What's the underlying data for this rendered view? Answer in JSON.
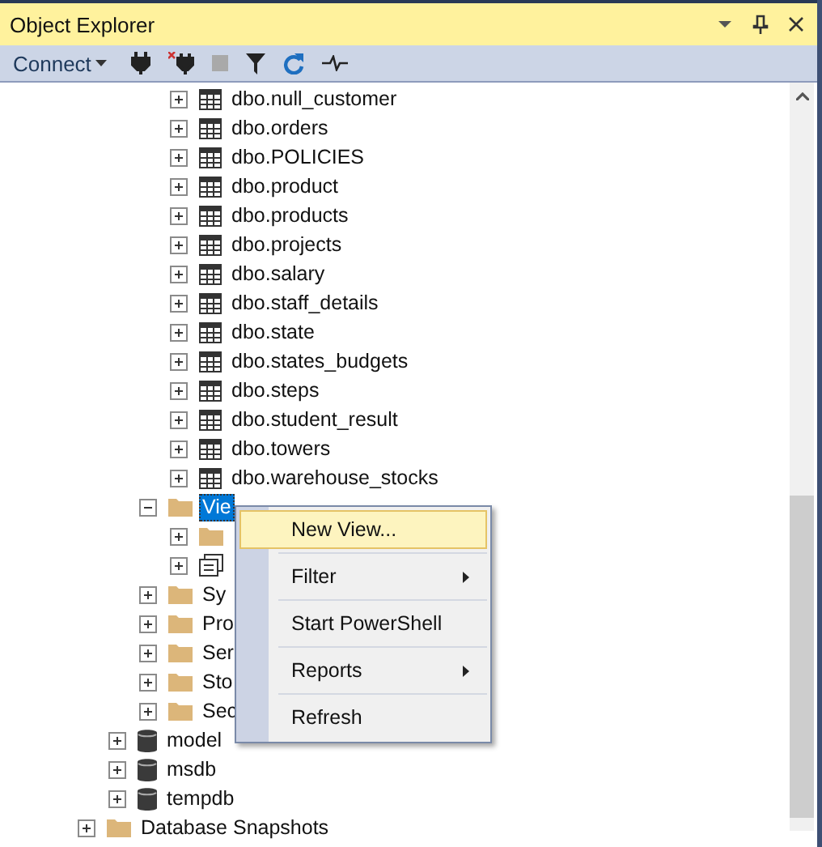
{
  "window": {
    "title": "Object Explorer"
  },
  "toolbar": {
    "connect_label": "Connect"
  },
  "tree": [
    {
      "children": [
        {
          "children": [
            {
              "children": [
                {
                  "label": "dbo.null_customer",
                  "kind": "table",
                  "expanded": false,
                  "selected": false
                },
                {
                  "label": "dbo.orders",
                  "kind": "table",
                  "expanded": false,
                  "selected": false
                },
                {
                  "label": "dbo.POLICIES",
                  "kind": "table",
                  "expanded": false,
                  "selected": false
                },
                {
                  "label": "dbo.product",
                  "kind": "table",
                  "expanded": false,
                  "selected": false
                },
                {
                  "label": "dbo.products",
                  "kind": "table",
                  "expanded": false,
                  "selected": false
                },
                {
                  "label": "dbo.projects",
                  "kind": "table",
                  "expanded": false,
                  "selected": false
                },
                {
                  "label": "dbo.salary",
                  "kind": "table",
                  "expanded": false,
                  "selected": false
                },
                {
                  "label": "dbo.staff_details",
                  "kind": "table",
                  "expanded": false,
                  "selected": false
                },
                {
                  "label": "dbo.state",
                  "kind": "table",
                  "expanded": false,
                  "selected": false
                },
                {
                  "label": "dbo.states_budgets",
                  "kind": "table",
                  "expanded": false,
                  "selected": false
                },
                {
                  "label": "dbo.steps",
                  "kind": "table",
                  "expanded": false,
                  "selected": false
                },
                {
                  "label": "dbo.student_result",
                  "kind": "table",
                  "expanded": false,
                  "selected": false
                },
                {
                  "label": "dbo.towers",
                  "kind": "table",
                  "expanded": false,
                  "selected": false
                },
                {
                  "label": "dbo.warehouse_stocks",
                  "kind": "table",
                  "expanded": false,
                  "selected": false
                }
              ]
            },
            {
              "label": "Vie",
              "kind": "folder",
              "expanded": true,
              "selected": true,
              "children": [
                {
                  "kind": "folder",
                  "expanded": false,
                  "selected": false
                },
                {
                  "kind": "view",
                  "expanded": false,
                  "selected": false
                }
              ]
            },
            {
              "label": "Sy",
              "kind": "folder",
              "expanded": false,
              "selected": false
            },
            {
              "label": "Pro",
              "kind": "folder",
              "expanded": false,
              "selected": false
            },
            {
              "label": "Ser",
              "kind": "folder",
              "expanded": false,
              "selected": false
            },
            {
              "label": "Sto",
              "kind": "folder",
              "expanded": false,
              "selected": false
            },
            {
              "label": "Sec",
              "kind": "folder",
              "expanded": false,
              "selected": false
            }
          ]
        },
        {
          "label": "model",
          "kind": "database",
          "expanded": false,
          "selected": false
        },
        {
          "label": "msdb",
          "kind": "database",
          "expanded": false,
          "selected": false
        },
        {
          "label": "tempdb",
          "kind": "database",
          "expanded": false,
          "selected": false
        }
      ]
    },
    {
      "label": "Database Snapshots",
      "kind": "folder",
      "expanded": false,
      "selected": false
    }
  ],
  "context_menu": [
    {
      "label": "New View...",
      "submenu": false,
      "selected": true
    },
    {
      "label": "Filter",
      "submenu": true,
      "selected": false
    },
    {
      "label": "Start PowerShell",
      "submenu": false,
      "selected": false
    },
    {
      "label": "Reports",
      "submenu": true,
      "selected": false
    },
    {
      "label": "Refresh",
      "submenu": false,
      "selected": false
    }
  ]
}
